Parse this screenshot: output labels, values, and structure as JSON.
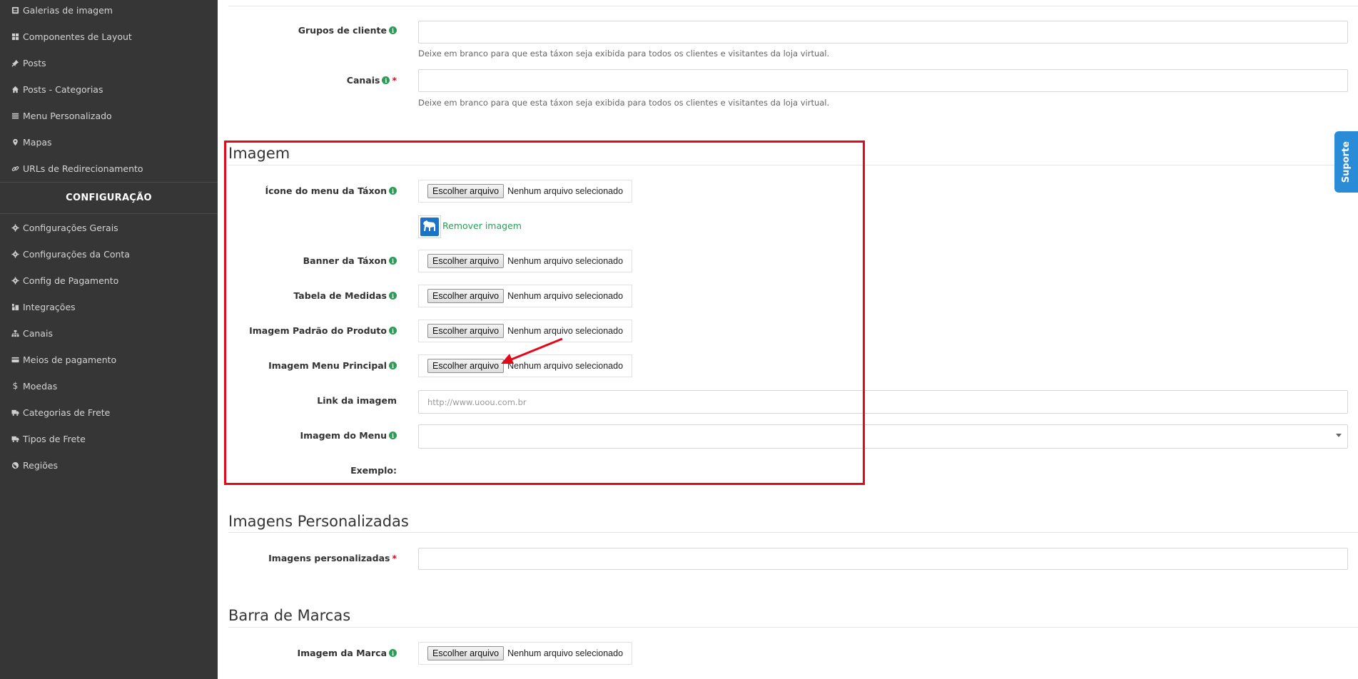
{
  "sidebar": {
    "items_top": [
      {
        "label": "Galerias de imagem",
        "icon": "image-gallery-icon"
      },
      {
        "label": "Componentes de Layout",
        "icon": "grid-icon"
      },
      {
        "label": "Posts",
        "icon": "pin-icon"
      },
      {
        "label": "Posts - Categorias",
        "icon": "home-icon"
      },
      {
        "label": "Menu Personalizado",
        "icon": "list-icon"
      },
      {
        "label": "Mapas",
        "icon": "map-marker-icon"
      },
      {
        "label": "URLs de Redirecionamento",
        "icon": "link-icon"
      }
    ],
    "section_title": "CONFIGURAÇÃO",
    "items_config": [
      {
        "label": "Configurações Gerais",
        "icon": "gear-icon"
      },
      {
        "label": "Configurações da Conta",
        "icon": "gear-icon"
      },
      {
        "label": "Config de Pagamento",
        "icon": "gear-icon"
      },
      {
        "label": "Integrações",
        "icon": "plug-icon"
      },
      {
        "label": "Canais",
        "icon": "sitemap-icon"
      },
      {
        "label": "Meios de pagamento",
        "icon": "credit-card-icon"
      },
      {
        "label": "Moedas",
        "icon": "dollar-icon"
      },
      {
        "label": "Categorias de Frete",
        "icon": "truck-icon"
      },
      {
        "label": "Tipos de Frete",
        "icon": "truck-icon"
      },
      {
        "label": "Regiões",
        "icon": "globe-icon"
      }
    ]
  },
  "visibility": {
    "customer_groups_label": "Grupos de cliente",
    "customer_groups_help": "Deixe em branco para que esta táxon seja exibida para todos os clientes e visitantes da loja virtual.",
    "channels_label": "Canais",
    "channels_help": "Deixe em branco para que esta táxon seja exibida para todos os clientes e visitantes da loja virtual."
  },
  "image_section": {
    "title": "Imagem",
    "menu_icon_label": "Ícone do menu da Táxon",
    "remove_image": "Remover imagem",
    "banner_label": "Banner da Táxon",
    "size_table_label": "Tabela de Medidas",
    "default_product_image_label": "Imagem Padrão do Produto",
    "main_menu_image_label": "Imagem Menu Principal",
    "image_link_label": "Link da imagem",
    "image_link_placeholder": "http://www.uoou.com.br",
    "menu_image_label": "Imagem do Menu",
    "example_label": "Exemplo:"
  },
  "file_input": {
    "button": "Escolher arquivo",
    "status": "Nenhum arquivo selecionado"
  },
  "custom_images": {
    "title": "Imagens Personalizadas",
    "label": "Imagens personalizadas"
  },
  "brand_bar": {
    "title": "Barra de Marcas",
    "brand_image_label": "Imagem da Marca"
  },
  "support_tab": "Suporte",
  "colors": {
    "sidebar_bg": "#363636",
    "accent_green": "#2a9d55",
    "highlight_red": "#e10a1a",
    "support_blue": "#2a8bd6"
  }
}
